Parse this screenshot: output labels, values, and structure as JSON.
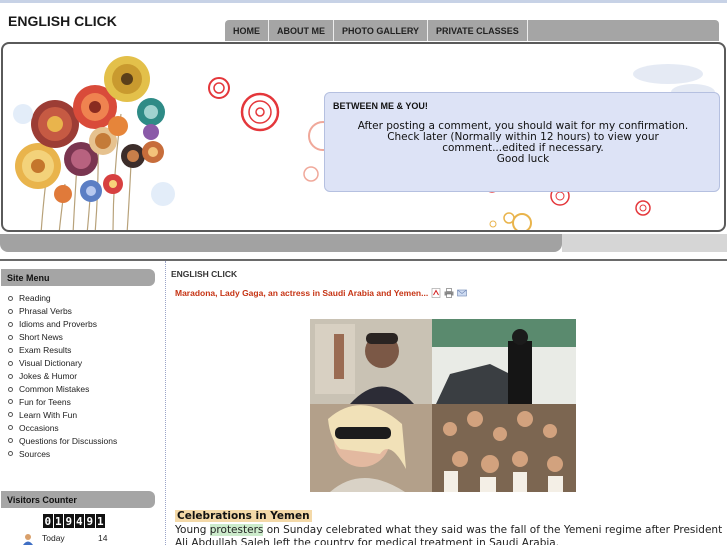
{
  "site": {
    "title": "ENGLISH CLICK"
  },
  "nav": {
    "items": [
      "HOME",
      "ABOUT ME",
      "PHOTO GALLERY",
      "PRIVATE CLASSES"
    ]
  },
  "notice": {
    "title": "BETWEEN ME & YOU!",
    "line1": "After posting a comment, you should wait for my confirmation.",
    "line2": "Check later (Normally within 12 hours) to view your",
    "line3": "comment...edited if necessary.",
    "line4": "Good luck"
  },
  "sidebar": {
    "menu_title": "Site Menu",
    "items": [
      "Reading",
      "Phrasal Verbs",
      "Idioms and Proverbs",
      "Short News",
      "Exam Results",
      "Visual Dictionary",
      "Jokes & Humor",
      "Common Mistakes",
      "Fun for Teens",
      "Learn With Fun",
      "Occasions",
      "Questions for Discussions",
      "Sources"
    ],
    "counter_title": "Visitors Counter",
    "counter_digits": [
      "0",
      "1",
      "9",
      "4",
      "9",
      "1"
    ],
    "today_label": "Today",
    "today_value": "14"
  },
  "content": {
    "section_label": "ENGLISH CLICK",
    "article_title": "Maradona, Lady Gaga, an actress in Saudi Arabia and Yemen...",
    "heading": "Celebrations in Yemen",
    "para_start": "Young ",
    "para_highlight": "protesters",
    "para_rest": " on Sunday celebrated what they said was the fall of the Yemeni regime after President Ali Abdullah Saleh left the country for medical treatment in Saudi Arabia."
  },
  "icons": {
    "pdf": "pdf-icon",
    "print": "print-icon",
    "email": "email-icon",
    "user": "user-icon"
  },
  "colors": {
    "nav_bg": "#a5a5a5",
    "notice_bg": "#dde3f6",
    "article_title": "#c63414",
    "heading_bg": "#f4d9a8",
    "highlight": "#cdeccc"
  }
}
